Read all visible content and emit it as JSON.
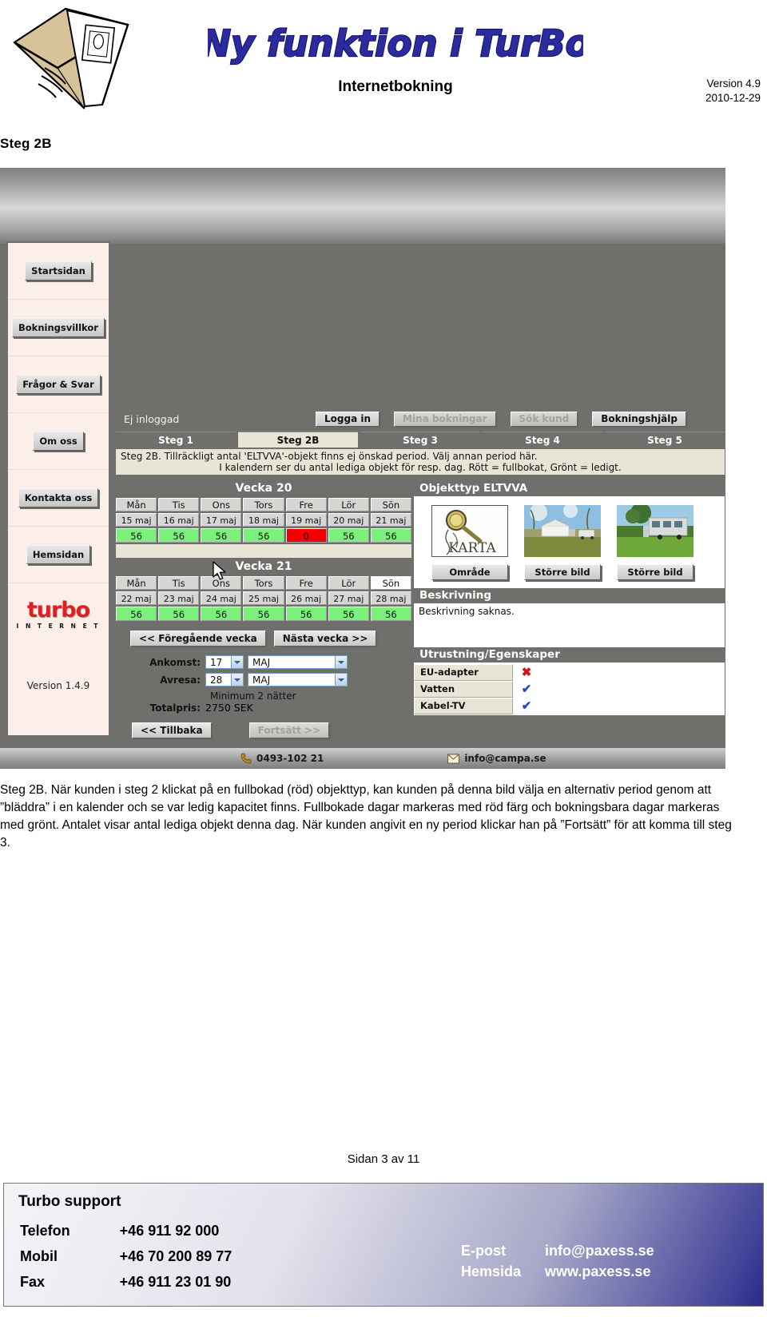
{
  "doc": {
    "title": "Ny funktion i TurBo",
    "subtitle": "Internetbokning",
    "version_label": "Version 4.9",
    "date": "2010-12-29",
    "step_heading": "Steg 2B",
    "page_number": "Sidan 3 av 11",
    "body_text": "Steg 2B. När kunden i steg 2 klickat på en fullbokad (röd) objekttyp, kan kunden på denna bild välja en alternativ period genom att ”bläddra” i en kalender och se var ledig kapacitet finns. Fullbokade dagar markeras med röd färg och bokningsbara dagar markeras med grönt. Antalet visar antal lediga objekt denna dag. När kunden angivit en ny period klickar han på ”Fortsätt” för att komma till steg 3."
  },
  "app": {
    "login_status": "Ej inloggad",
    "top_buttons": [
      {
        "label": "Logga in",
        "enabled": true
      },
      {
        "label": "Mina bokningar",
        "enabled": false
      },
      {
        "label": "Sök kund",
        "enabled": false
      },
      {
        "label": "Bokningshjälp",
        "enabled": true
      }
    ],
    "steps": [
      {
        "label": "Steg 1",
        "active": false
      },
      {
        "label": "Steg 2B",
        "active": true
      },
      {
        "label": "Steg 3",
        "active": false
      },
      {
        "label": "Steg 4",
        "active": false
      },
      {
        "label": "Steg 5",
        "active": false
      }
    ],
    "info_line_1": "Steg 2B. Tillräckligt antal 'ELTVVA'-objekt finns ej önskad period. Välj annan period här.",
    "info_line_2": "I kalendern ser du antal lediga objekt för resp. dag. Rött = fullbokat, Grönt = ledigt.",
    "sidebar": {
      "items": [
        {
          "label": "Startsidan"
        },
        {
          "label": "Bokningsvillkor"
        },
        {
          "label": "Frågor & Svar"
        },
        {
          "label": "Om oss"
        },
        {
          "label": "Kontakta oss"
        },
        {
          "label": "Hemsidan"
        }
      ],
      "logo_word": "turbo",
      "logo_sub": "I N T E R N E T",
      "version": "Version 1.4.9"
    },
    "calendar": {
      "weeks": [
        {
          "title": "Vecka 20",
          "days": [
            {
              "dow": "Mån",
              "date": "15 maj",
              "capacity": "56",
              "full": false,
              "weekend": false
            },
            {
              "dow": "Tis",
              "date": "16 maj",
              "capacity": "56",
              "full": false,
              "weekend": false
            },
            {
              "dow": "Ons",
              "date": "17 maj",
              "capacity": "56",
              "full": false,
              "weekend": false
            },
            {
              "dow": "Tors",
              "date": "18 maj",
              "capacity": "56",
              "full": false,
              "weekend": false
            },
            {
              "dow": "Fre",
              "date": "19 maj",
              "capacity": "0",
              "full": true,
              "weekend": false
            },
            {
              "dow": "Lör",
              "date": "20 maj",
              "capacity": "56",
              "full": false,
              "weekend": false
            },
            {
              "dow": "Sön",
              "date": "21 maj",
              "capacity": "56",
              "full": false,
              "weekend": true
            }
          ]
        },
        {
          "title": "Vecka 21",
          "days": [
            {
              "dow": "Mån",
              "date": "22 maj",
              "capacity": "56",
              "full": false,
              "weekend": false
            },
            {
              "dow": "Tis",
              "date": "23 maj",
              "capacity": "56",
              "full": false,
              "weekend": false
            },
            {
              "dow": "Ons",
              "date": "24 maj",
              "capacity": "56",
              "full": false,
              "weekend": false
            },
            {
              "dow": "Tors",
              "date": "25 maj",
              "capacity": "56",
              "full": false,
              "weekend": false
            },
            {
              "dow": "Fre",
              "date": "26 maj",
              "capacity": "56",
              "full": false,
              "weekend": false
            },
            {
              "dow": "Lör",
              "date": "27 maj",
              "capacity": "56",
              "full": false,
              "weekend": false
            },
            {
              "dow": "Sön",
              "date": "28 maj",
              "capacity": "56",
              "full": false,
              "weekend": true
            }
          ]
        }
      ],
      "prev_week_label": "<< Föregående vecka",
      "next_week_label": "Nästa vecka >>"
    },
    "form": {
      "arrival_label": "Ankomst:",
      "arrival_day": "17",
      "arrival_month": "MAJ",
      "departure_label": "Avresa:",
      "departure_day": "28",
      "departure_month": "MAJ",
      "minimum_note": "Minimum 2 nätter",
      "total_label": "Totalpris:",
      "total_value": "2750 SEK",
      "back_label": "<< Tillbaka",
      "continue_label": "Fortsätt >>"
    },
    "object": {
      "type_heading": "Objekttyp ELTVVA",
      "map_caption": "KARTA",
      "map_button": "Område",
      "image_button_1": "Större bild",
      "image_button_2": "Större bild",
      "description_heading": "Beskrivning",
      "description_text": "Beskrivning saknas.",
      "equipment_heading": "Utrustning/Egenskaper",
      "equipment": [
        {
          "name": "EU-adapter",
          "available": false
        },
        {
          "name": "Vatten",
          "available": true
        },
        {
          "name": "Kabel-TV",
          "available": true
        }
      ]
    },
    "statusbar": {
      "phone": "0493-102 21",
      "email": "info@campa.se"
    }
  },
  "contact": {
    "title": "Turbo support",
    "rows": [
      {
        "label": "Telefon",
        "value": "+46 911 92 000"
      },
      {
        "label": "Mobil",
        "value": "+46 70 200 89 77"
      },
      {
        "label": "Fax",
        "value": "+46 911 23 01 90"
      }
    ],
    "rows_right": [
      {
        "label": "E-post",
        "value": "info@paxess.se"
      },
      {
        "label": "Hemsida",
        "value": "www.paxess.se"
      }
    ]
  },
  "colors": {
    "title_blue": "#2b2b9e",
    "available_green": "#7bf07b",
    "full_red": "#f40000",
    "panel_gray": "#6f6f6c",
    "cream": "#e8e4d6"
  }
}
